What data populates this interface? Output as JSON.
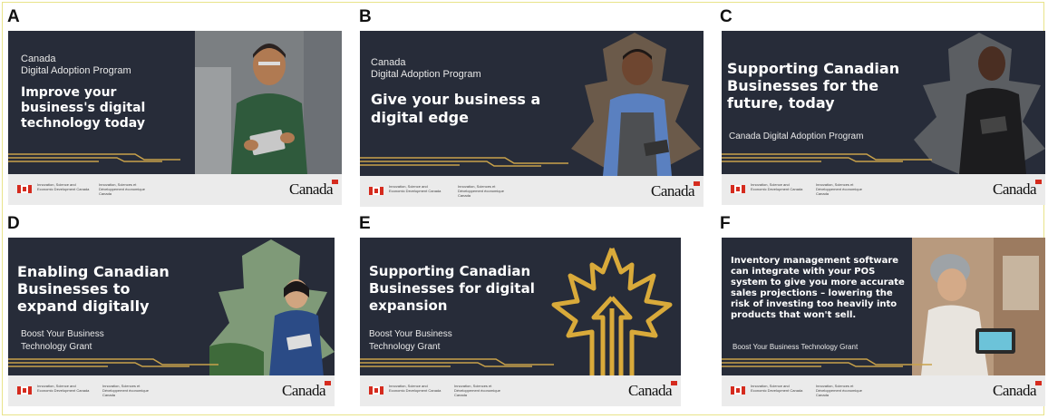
{
  "letters": [
    "A",
    "B",
    "C",
    "D",
    "E",
    "F"
  ],
  "footer": {
    "dept_en": "Innovation, Science and Economic Development Canada",
    "dept_fr": "Innovation, Sciences et Développement économique Canada",
    "wordmark": "Canada"
  },
  "panels": {
    "A": {
      "line1": "Canada",
      "line2": "Digital Adoption Program",
      "headline": "Improve your business's digital technology today"
    },
    "B": {
      "line1": "Canada",
      "line2": "Digital Adoption Program",
      "headline": "Give your business a digital edge"
    },
    "C": {
      "headline": "Supporting Canadian Businesses for the future, today",
      "sub": "Canada Digital Adoption Program"
    },
    "D": {
      "headline": "Enabling Canadian Businesses to expand digitally",
      "sub": "Boost Your Business Technology Grant"
    },
    "E": {
      "headline": "Supporting Canadian Businesses for digital expansion",
      "sub": "Boost Your Business Technology Grant"
    },
    "F": {
      "headline": "Inventory management software can integrate with your POS system to give you more accurate sales projections – lowering the risk of investing too heavily into products that won't sell.",
      "sub": "Boost Your Business Technology Grant"
    }
  },
  "colors": {
    "panel_bg": "#272c39",
    "gold": "#c9a24a",
    "red": "#d52b1e",
    "footer_bg": "#ebebeb"
  }
}
